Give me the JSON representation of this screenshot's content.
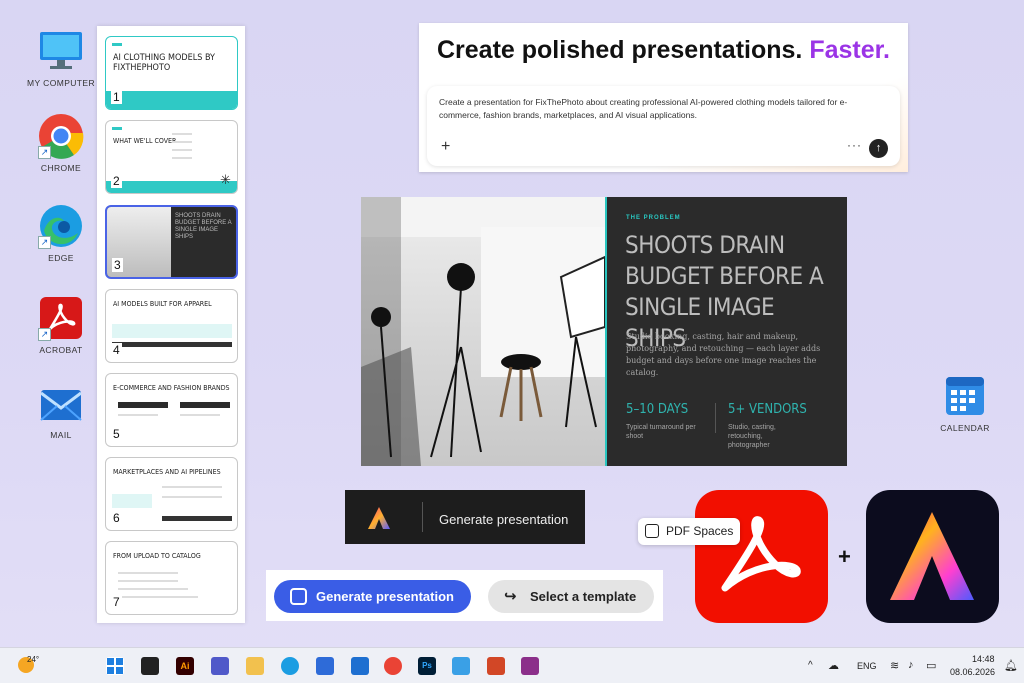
{
  "desktop": {
    "icons": [
      {
        "label": "MY COMPUTER"
      },
      {
        "label": "CHROME"
      },
      {
        "label": "EDGE"
      },
      {
        "label": "ACROBAT"
      },
      {
        "label": "MAIL"
      },
      {
        "label": "CALENDAR"
      }
    ]
  },
  "slides": [
    {
      "num": "1",
      "title": "AI CLOTHING MODELS BY FIXTHEPHOTO"
    },
    {
      "num": "2",
      "title": "WHAT WE'LL COVER"
    },
    {
      "num": "3",
      "title": "SHOOTS DRAIN BUDGET BEFORE A SINGLE IMAGE SHIPS"
    },
    {
      "num": "4",
      "title": "AI MODELS BUILT FOR APPAREL"
    },
    {
      "num": "5",
      "title": "E-COMMERCE AND FASHION BRANDS"
    },
    {
      "num": "6",
      "title": "MARKETPLACES AND AI PIPELINES"
    },
    {
      "num": "7",
      "title": "FROM UPLOAD TO CATALOG"
    }
  ],
  "prompt": {
    "headline": "Create polished presentations.",
    "headline_accent": "Faster.",
    "text": "Create a presentation for FixThePhoto about creating professional AI-powered clothing models tailored for e-commerce, fashion brands, marketplaces, and AI visual applications.",
    "plus": "+",
    "more": "···",
    "send": "↑"
  },
  "preview": {
    "eyebrow": "THE PROBLEM",
    "title": "SHOOTS DRAIN BUDGET BEFORE A SINGLE IMAGE SHIPS",
    "body": "Studio booking, casting, hair and makeup, photography, and retouching — each layer adds budget and days before one image reaches the catalog.",
    "stat1_value": "5–10 DAYS",
    "stat1_label": "Typical turnaround per shoot",
    "stat2_value": "5+ VENDORS",
    "stat2_label": "Studio, casting, retouching, photographer"
  },
  "buttons": {
    "generate_dark": "Generate presentation",
    "generate": "Generate presentation",
    "template": "Select a template",
    "pdf_spaces": "PDF Spaces",
    "plus_sign": "+"
  },
  "taskbar": {
    "weather": "24°",
    "lang": "ENG",
    "time": "14:48",
    "date": "08.06.2026"
  },
  "colors": {
    "accent_purple": "#9b34e6",
    "teal": "#29c6c0",
    "blue_button": "#3a5de6",
    "acrobat_red": "#f20f00"
  }
}
